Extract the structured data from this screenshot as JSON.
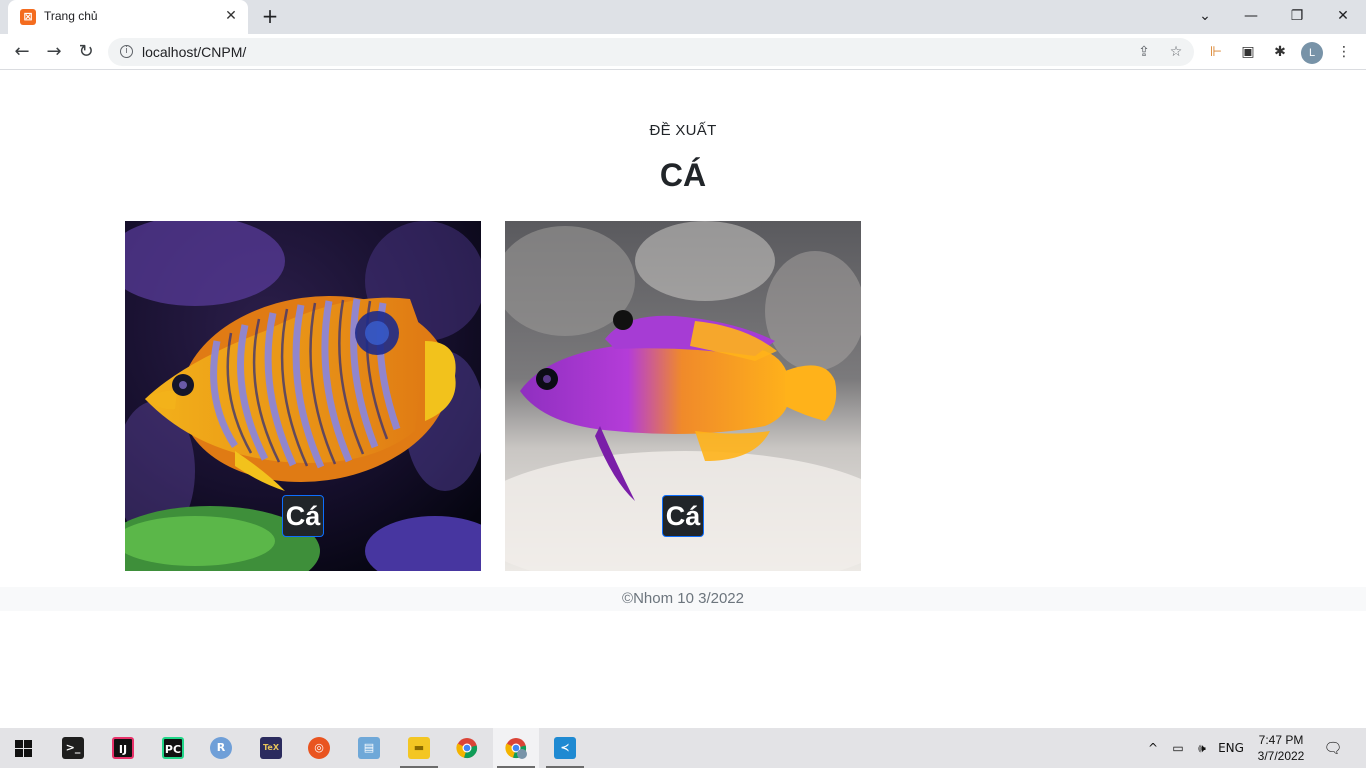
{
  "browser": {
    "tab_title": "Trang chủ",
    "tab_close": "✕",
    "new_tab": "+",
    "url": "localhost/CNPM/",
    "window_controls": {
      "dropdown": "⌄",
      "minimize": "—",
      "restore": "❐",
      "close": "✕"
    },
    "profile_initial": "L"
  },
  "page": {
    "subtitle": "ĐỀ XUẤT",
    "heading": "CÁ",
    "cards": [
      {
        "label": "Cá"
      },
      {
        "label": "Cá"
      }
    ],
    "footer": "©Nhom 10 3/2022"
  },
  "taskbar": {
    "apps": [
      {
        "name": "terminal",
        "icon": "terminal-icon"
      },
      {
        "name": "intellij",
        "icon": "intellij-icon",
        "text": "IJ"
      },
      {
        "name": "pycharm",
        "icon": "pycharm-icon",
        "text": "PC"
      },
      {
        "name": "r",
        "icon": "r-icon",
        "text": "R"
      },
      {
        "name": "texstudio",
        "icon": "tex-icon",
        "text": "TeX"
      },
      {
        "name": "ubuntu",
        "icon": "ubuntu-icon"
      },
      {
        "name": "vm",
        "icon": "virtualbox-icon"
      },
      {
        "name": "explorer",
        "icon": "folder-icon"
      },
      {
        "name": "chrome",
        "icon": "chrome-icon"
      },
      {
        "name": "chrome-profile",
        "icon": "chrome-profile-icon"
      },
      {
        "name": "vscode",
        "icon": "vscode-icon"
      }
    ],
    "language": "ENG",
    "time": "7:47 PM",
    "date": "3/7/2022"
  }
}
